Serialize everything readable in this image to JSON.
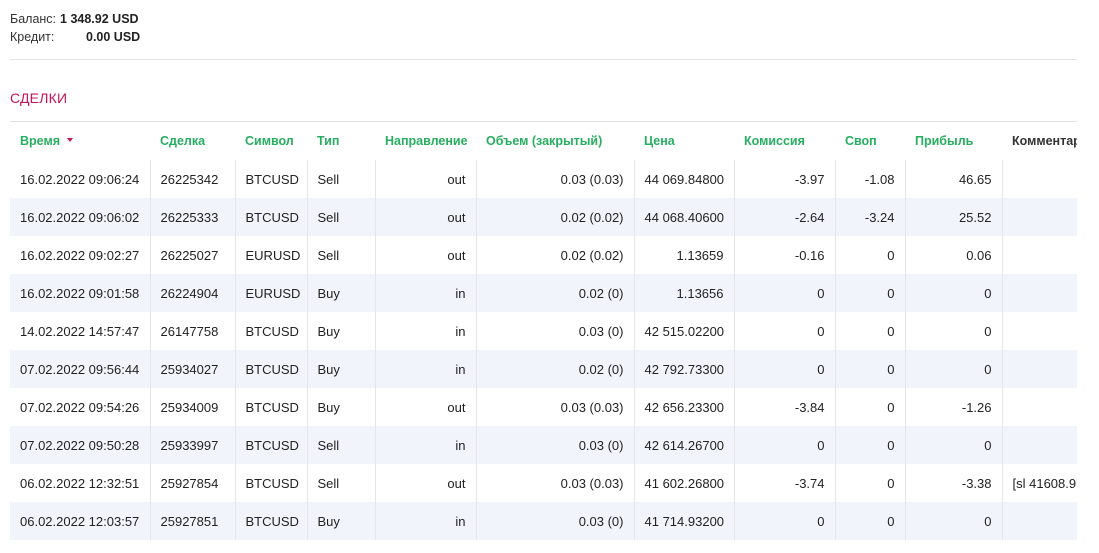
{
  "summary": {
    "balance_label": "Баланс:",
    "balance_value": "1 348.92 USD",
    "credit_label": "Кредит:",
    "credit_value": "0.00 USD"
  },
  "section_title": "СДЕЛКИ",
  "columns": [
    "Время",
    "Сделка",
    "Символ",
    "Тип",
    "Направление",
    "Объем (закрытый)",
    "Цена",
    "Комиссия",
    "Своп",
    "Прибыль",
    "Комментарий"
  ],
  "colors": {
    "header_green": "#27ae60",
    "section_red": "#c2185b",
    "stripe": "#f1f5fb"
  },
  "rows": [
    {
      "time": "16.02.2022 09:06:24",
      "deal": "26225342",
      "symbol": "BTCUSD",
      "type": "Sell",
      "direction": "out",
      "volume": "0.03 (0.03)",
      "price": "44 069.84800",
      "commission": "-3.97",
      "swap": "-1.08",
      "profit": "46.65",
      "comment": ""
    },
    {
      "time": "16.02.2022 09:06:02",
      "deal": "26225333",
      "symbol": "BTCUSD",
      "type": "Sell",
      "direction": "out",
      "volume": "0.02 (0.02)",
      "price": "44 068.40600",
      "commission": "-2.64",
      "swap": "-3.24",
      "profit": "25.52",
      "comment": ""
    },
    {
      "time": "16.02.2022 09:02:27",
      "deal": "26225027",
      "symbol": "EURUSD",
      "type": "Sell",
      "direction": "out",
      "volume": "0.02 (0.02)",
      "price": "1.13659",
      "commission": "-0.16",
      "swap": "0",
      "profit": "0.06",
      "comment": ""
    },
    {
      "time": "16.02.2022 09:01:58",
      "deal": "26224904",
      "symbol": "EURUSD",
      "type": "Buy",
      "direction": "in",
      "volume": "0.02 (0)",
      "price": "1.13656",
      "commission": "0",
      "swap": "0",
      "profit": "0",
      "comment": ""
    },
    {
      "time": "14.02.2022 14:57:47",
      "deal": "26147758",
      "symbol": "BTCUSD",
      "type": "Buy",
      "direction": "in",
      "volume": "0.03 (0)",
      "price": "42 515.02200",
      "commission": "0",
      "swap": "0",
      "profit": "0",
      "comment": ""
    },
    {
      "time": "07.02.2022 09:56:44",
      "deal": "25934027",
      "symbol": "BTCUSD",
      "type": "Buy",
      "direction": "in",
      "volume": "0.02 (0)",
      "price": "42 792.73300",
      "commission": "0",
      "swap": "0",
      "profit": "0",
      "comment": ""
    },
    {
      "time": "07.02.2022 09:54:26",
      "deal": "25934009",
      "symbol": "BTCUSD",
      "type": "Buy",
      "direction": "out",
      "volume": "0.03 (0.03)",
      "price": "42 656.23300",
      "commission": "-3.84",
      "swap": "0",
      "profit": "-1.26",
      "comment": ""
    },
    {
      "time": "07.02.2022 09:50:28",
      "deal": "25933997",
      "symbol": "BTCUSD",
      "type": "Sell",
      "direction": "in",
      "volume": "0.03 (0)",
      "price": "42 614.26700",
      "commission": "0",
      "swap": "0",
      "profit": "0",
      "comment": ""
    },
    {
      "time": "06.02.2022 12:32:51",
      "deal": "25927854",
      "symbol": "BTCUSD",
      "type": "Sell",
      "direction": "out",
      "volume": "0.03 (0.03)",
      "price": "41 602.26800",
      "commission": "-3.74",
      "swap": "0",
      "profit": "-3.38",
      "comment": "[sl 41608.9"
    },
    {
      "time": "06.02.2022 12:03:57",
      "deal": "25927851",
      "symbol": "BTCUSD",
      "type": "Buy",
      "direction": "in",
      "volume": "0.03 (0)",
      "price": "41 714.93200",
      "commission": "0",
      "swap": "0",
      "profit": "0",
      "comment": ""
    }
  ]
}
